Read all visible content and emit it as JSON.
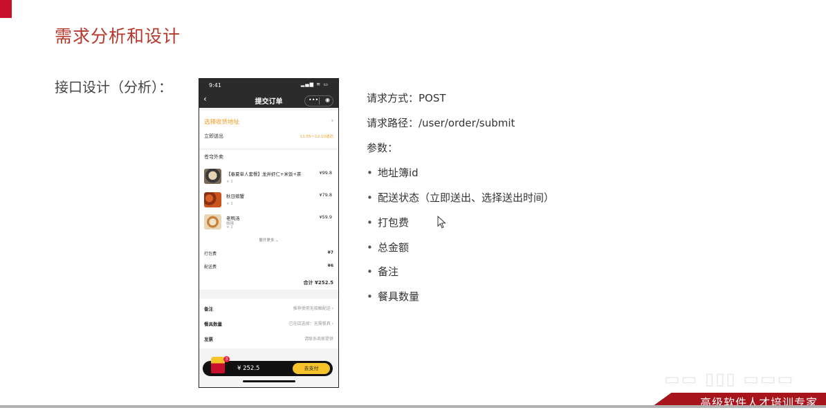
{
  "slide": {
    "title": "需求分析和设计",
    "subtitle": "接口设计（分析）："
  },
  "phone": {
    "status_time": "9:41",
    "status_icons": "▂▄▆ ≋ ▭",
    "back_icon": "‹",
    "nav_title": "提交订单",
    "capsule_more": "•••",
    "capsule_record": "◉",
    "address_label": "选择收货地址",
    "address_chevron": "›",
    "deliver_label": "立即送出",
    "deliver_time": "11:55～12:10送达",
    "store_name": "苍穹外卖",
    "items": [
      {
        "name": "【春夏单人套餐】龙井虾仁+米饭+茶",
        "qty": "× 1",
        "price": "¥99.8",
        "note": ""
      },
      {
        "name": "秋日螃蟹",
        "qty": "× 1",
        "price": "¥79.8",
        "note": ""
      },
      {
        "name": "老鸭汤",
        "qty": "× 1",
        "price": "¥59.9",
        "note": "微辣"
      }
    ],
    "expand_more": "展开更多 ⌄",
    "packing_fee_label": "打包费",
    "packing_fee": "¥7",
    "delivery_fee_label": "配送费",
    "delivery_fee": "¥6",
    "total": "合计 ¥252.5",
    "remark_label": "备注",
    "remark_value": "推荐使用无接触配送 ›",
    "tableware_label": "餐具数量",
    "tableware_value": "已在店选择：无需餐具 ›",
    "invoice_label": "发票",
    "invoice_value": "请联系商家提供",
    "cart_badge": "3",
    "pay_amount": "¥ 252.5",
    "pay_button": "去支付"
  },
  "api": {
    "method": "请求方式：POST",
    "path": "请求路径：/user/order/submit",
    "params_label": "参数：",
    "params": [
      "地址簿id",
      "配送状态（立即送出、选择送出时间）",
      "打包费",
      "总金额",
      "备注",
      "餐具数量"
    ],
    "bullet": "•"
  },
  "footer_text": "高级软件人才培训专家",
  "colors": {
    "title": "#b8362a",
    "accent_orange": "#f29a1e",
    "pay_yellow": "#f6c42a",
    "footer_red": "#a8141c"
  }
}
